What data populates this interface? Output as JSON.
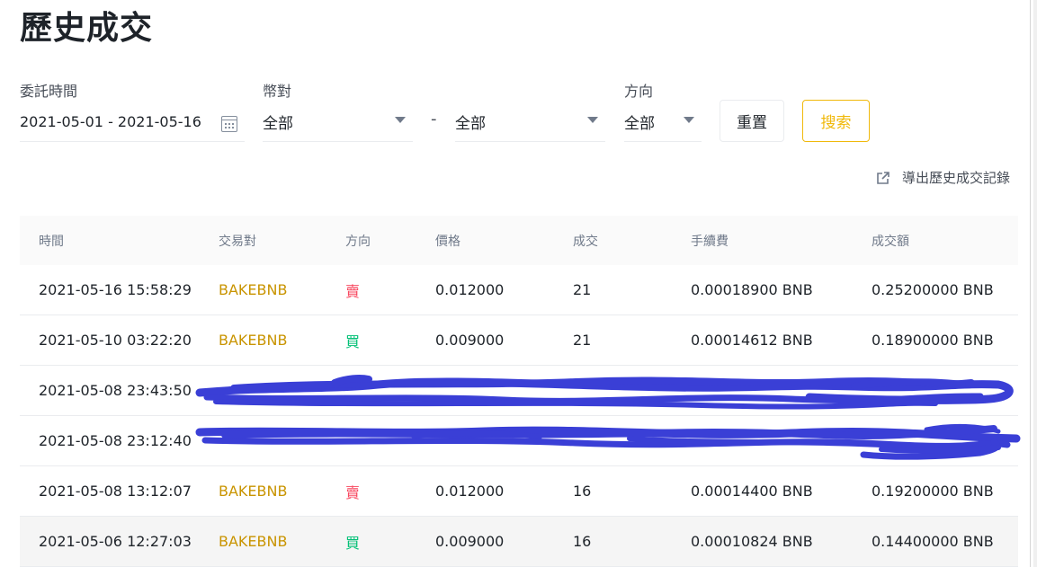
{
  "page": {
    "title": "歷史成交"
  },
  "filters": {
    "time_label": "委託時間",
    "date_range": "2021-05-01 - 2021-05-16",
    "pair_label": "幣對",
    "base": "全部",
    "separator": "-",
    "quote": "全部",
    "side_label": "方向",
    "side": "全部",
    "reset": "重置",
    "search": "搜索"
  },
  "export": {
    "label": "導出歷史成交記錄"
  },
  "table": {
    "headers": [
      "時間",
      "交易對",
      "方向",
      "價格",
      "成交",
      "手續費",
      "成交額"
    ],
    "rows": [
      {
        "time": "2021-05-16 15:58:29",
        "pair": "BAKEBNB",
        "side": "賣",
        "price": "0.012000",
        "filled": "21",
        "fee": "0.00018900 BNB",
        "total": "0.25200000 BNB"
      },
      {
        "time": "2021-05-10 03:22:20",
        "pair": "BAKEBNB",
        "side": "買",
        "price": "0.009000",
        "filled": "21",
        "fee": "0.00014612 BNB",
        "total": "0.18900000 BNB"
      },
      {
        "time": "2021-05-08 23:43:50"
      },
      {
        "time": "2021-05-08 23:12:40"
      },
      {
        "time": "2021-05-08 13:12:07",
        "pair": "BAKEBNB",
        "side": "賣",
        "price": "0.012000",
        "filled": "16",
        "fee": "0.00014400 BNB",
        "total": "0.19200000 BNB"
      },
      {
        "time": "2021-05-06 12:27:03",
        "pair": "BAKEBNB",
        "side": "買",
        "price": "0.009000",
        "filled": "16",
        "fee": "0.00010824 BNB",
        "total": "0.14400000 BNB"
      }
    ]
  },
  "colors": {
    "accent": "#f0b90b",
    "pair": "#c99400",
    "buy": "#02c076",
    "sell": "#f84960",
    "redaction": "#3a3fd6"
  },
  "icons": {
    "calendar": "calendar-icon",
    "dropdown": "caret-down-icon",
    "export": "external-link-icon"
  }
}
